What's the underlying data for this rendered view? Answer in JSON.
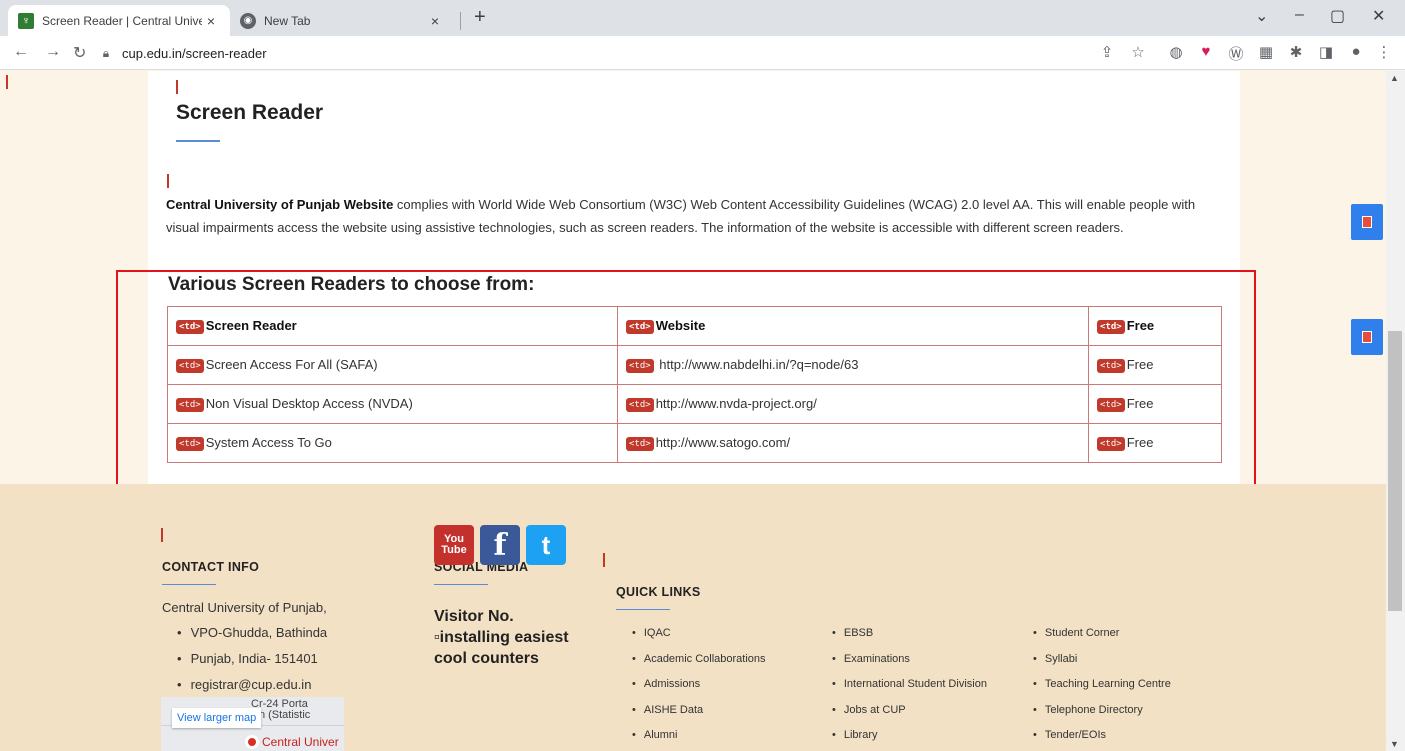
{
  "browser": {
    "tabs": [
      {
        "title": "Screen Reader | Central Universit",
        "close": "×"
      },
      {
        "title": "New Tab",
        "close": "×"
      }
    ],
    "new_tab": "+",
    "window_controls": {
      "minimize": "–",
      "maximize": "▢",
      "close": "✕",
      "tab_search": "⌄"
    },
    "url": "cup.edu.in/screen-reader"
  },
  "page": {
    "title": "Screen Reader",
    "intro_bold": "Central University of Punjab Website",
    "intro_text": " complies with World Wide Web Consortium (W3C) Web Content Accessibility Guidelines (WCAG) 2.0 level AA. This will enable people with visual impairments access the website using assistive technologies, such as screen readers. The information of the website is accessible with different screen readers.",
    "section_heading": "Various Screen Readers to choose from:",
    "td_tag": "<td>",
    "table": {
      "headers": [
        "Screen Reader",
        "Website",
        "Free"
      ],
      "rows": [
        [
          "Screen Access For All (SAFA)",
          " http://www.nabdelhi.in/?q=node/63",
          "Free"
        ],
        [
          "Non Visual Desktop Access (NVDA)",
          "http://www.nvda-project.org/",
          "Free"
        ],
        [
          "System Access To Go",
          "http://www.satogo.com/",
          "Free"
        ]
      ]
    }
  },
  "footer": {
    "contact": {
      "heading": "CONTACT INFO",
      "name": "Central University of Punjab,",
      "items": [
        "VPO-Ghudda, Bathinda",
        "Punjab, India- 151401",
        "registrar@cup.edu.in"
      ]
    },
    "social": {
      "heading": "SOCIAL MEDIA",
      "youtube_you": "You",
      "youtube_tube": "Tube",
      "facebook": "f",
      "twitter": "t"
    },
    "visitor_label": "Visitor No.",
    "counter_alt": "installing easiest cool counters",
    "map": {
      "view_larger": "View larger map",
      "place1": "Cr-24 Porta",
      "place2": "ɔin (Statistic",
      "place3": "Central Univer"
    },
    "quick_links": {
      "heading": "QUICK LINKS",
      "col1": [
        "IQAC",
        "Academic Collaborations",
        "Admissions",
        "AISHE Data",
        "Alumni"
      ],
      "col2": [
        "EBSB",
        "Examinations",
        "International Student Division",
        "Jobs at CUP",
        "Library"
      ],
      "col3": [
        "Student Corner",
        "Syllabi",
        "Teaching Learning Centre",
        "Telephone Directory",
        "Tender/EOIs"
      ]
    }
  }
}
